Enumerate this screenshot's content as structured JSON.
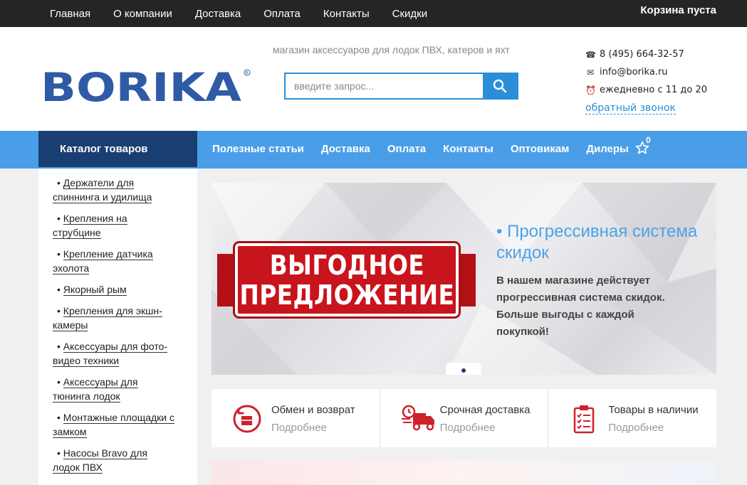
{
  "topbar": {
    "nav": [
      "Главная",
      "О компании",
      "Доставка",
      "Оплата",
      "Контакты",
      "Скидки"
    ],
    "cart": "Корзина пуста"
  },
  "header": {
    "logo_text": "BORIKA",
    "tagline": "магазин аксессуаров для лодок ПВХ, катеров и яхт",
    "search_placeholder": "введите запрос...",
    "phone": "8 (495) 664-32-57",
    "email": "info@borika.ru",
    "hours": "ежедневно с 11 до 20",
    "callback": "обратный звонок"
  },
  "mainnav": {
    "catalog": "Каталог товаров",
    "links": [
      "Полезные статьи",
      "Доставка",
      "Оплата",
      "Контакты",
      "Оптовикам",
      "Дилеры"
    ],
    "favorites_count": "0"
  },
  "sidebar": {
    "items": [
      {
        "line1": "Держатели для",
        "line2": "спиннинга и удилища"
      },
      {
        "line1": "Крепления на",
        "line2": "струбцине"
      },
      {
        "line1": "Крепление датчика",
        "line2": "эхолота"
      },
      {
        "line1": "Якорный рым",
        "line2": ""
      },
      {
        "line1": "Крепления для экшн-",
        "line2": "камеры"
      },
      {
        "line1": "Аксессуары для фото-",
        "line2": "видео техники"
      },
      {
        "line1": "Аксессуары для",
        "line2": "тюнинга лодок"
      },
      {
        "line1": "Монтажные площадки с",
        "line2": "замком"
      },
      {
        "line1": "Насосы Bravo для",
        "line2": "лодок ПВХ"
      }
    ]
  },
  "banner": {
    "badge_line1": "ВЫГОДНОЕ",
    "badge_line2": "ПРЕДЛОЖЕНИЕ",
    "title": "• Прогрессивная система скидок",
    "text": "В нашем магазине действует прогрессивная система скидок. Больше выгоды с каждой покупкой!",
    "slide_count": 1,
    "active_slide": 1
  },
  "features": [
    {
      "title": "Обмен и возврат",
      "more": "Подробнее",
      "icon": "return-box-icon"
    },
    {
      "title": "Срочная доставка",
      "more": "Подробнее",
      "icon": "delivery-truck-icon"
    },
    {
      "title": "Товары в наличии",
      "more": "Подробнее",
      "icon": "clipboard-checklist-icon"
    }
  ],
  "colors": {
    "topbar": "#252525",
    "accent_blue": "#2a8ed8",
    "nav_blue": "#4a9ee8",
    "catalog_dark": "#193f72",
    "logo_blue": "#2f5aa5",
    "offer_red": "#c8141c"
  }
}
